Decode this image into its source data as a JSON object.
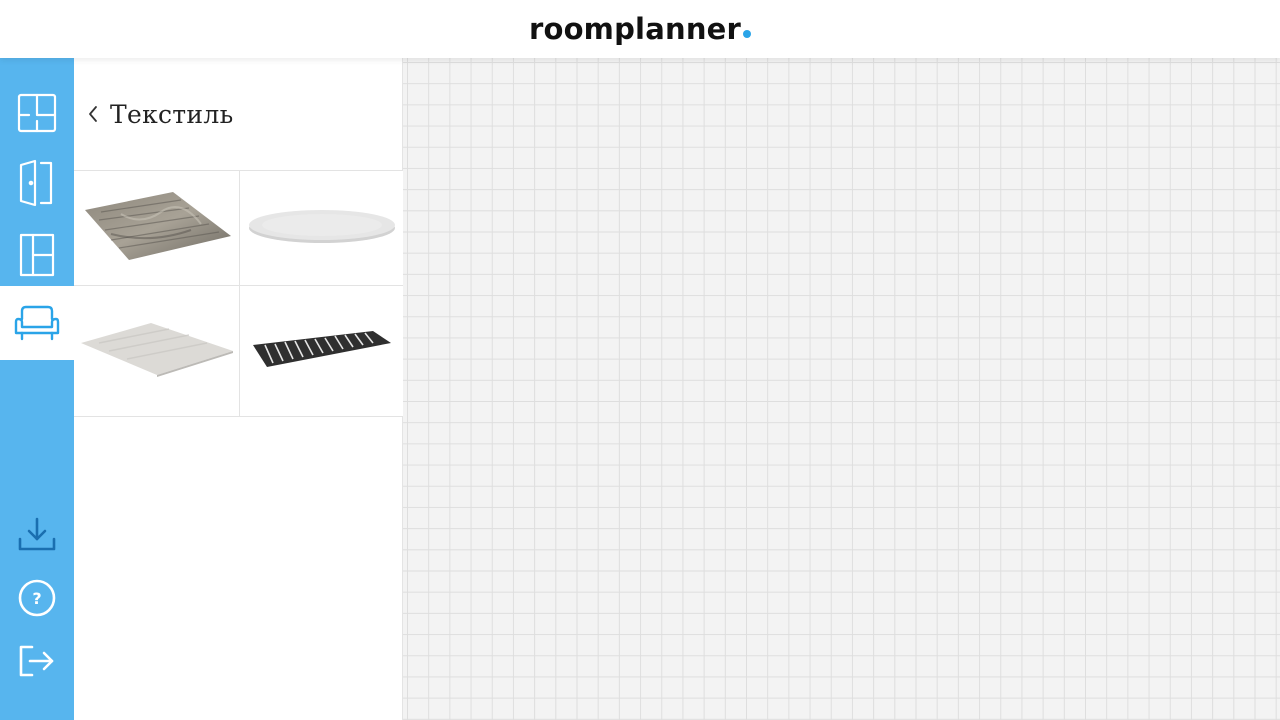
{
  "app": {
    "logo_text": "roomplanner",
    "accent_color": "#2aa4e8",
    "rail_color": "#57b5ee"
  },
  "rail": {
    "items": [
      {
        "name": "rooms",
        "icon": "floorplan-icon",
        "active": false
      },
      {
        "name": "doors",
        "icon": "door-icon",
        "active": false
      },
      {
        "name": "windows",
        "icon": "window-icon",
        "active": false
      },
      {
        "name": "furniture",
        "icon": "armchair-icon",
        "active": true
      }
    ],
    "bottom_items": [
      {
        "name": "download",
        "icon": "download-icon"
      },
      {
        "name": "help",
        "icon": "help-icon"
      },
      {
        "name": "exit",
        "icon": "logout-icon"
      }
    ]
  },
  "panel": {
    "title": "Текстиль",
    "back_icon": "chevron-left-icon",
    "items": [
      {
        "name": "rug-gray-distressed"
      },
      {
        "name": "rug-round-white"
      },
      {
        "name": "rug-light-gray"
      },
      {
        "name": "rug-dark-striped-runner"
      }
    ]
  }
}
